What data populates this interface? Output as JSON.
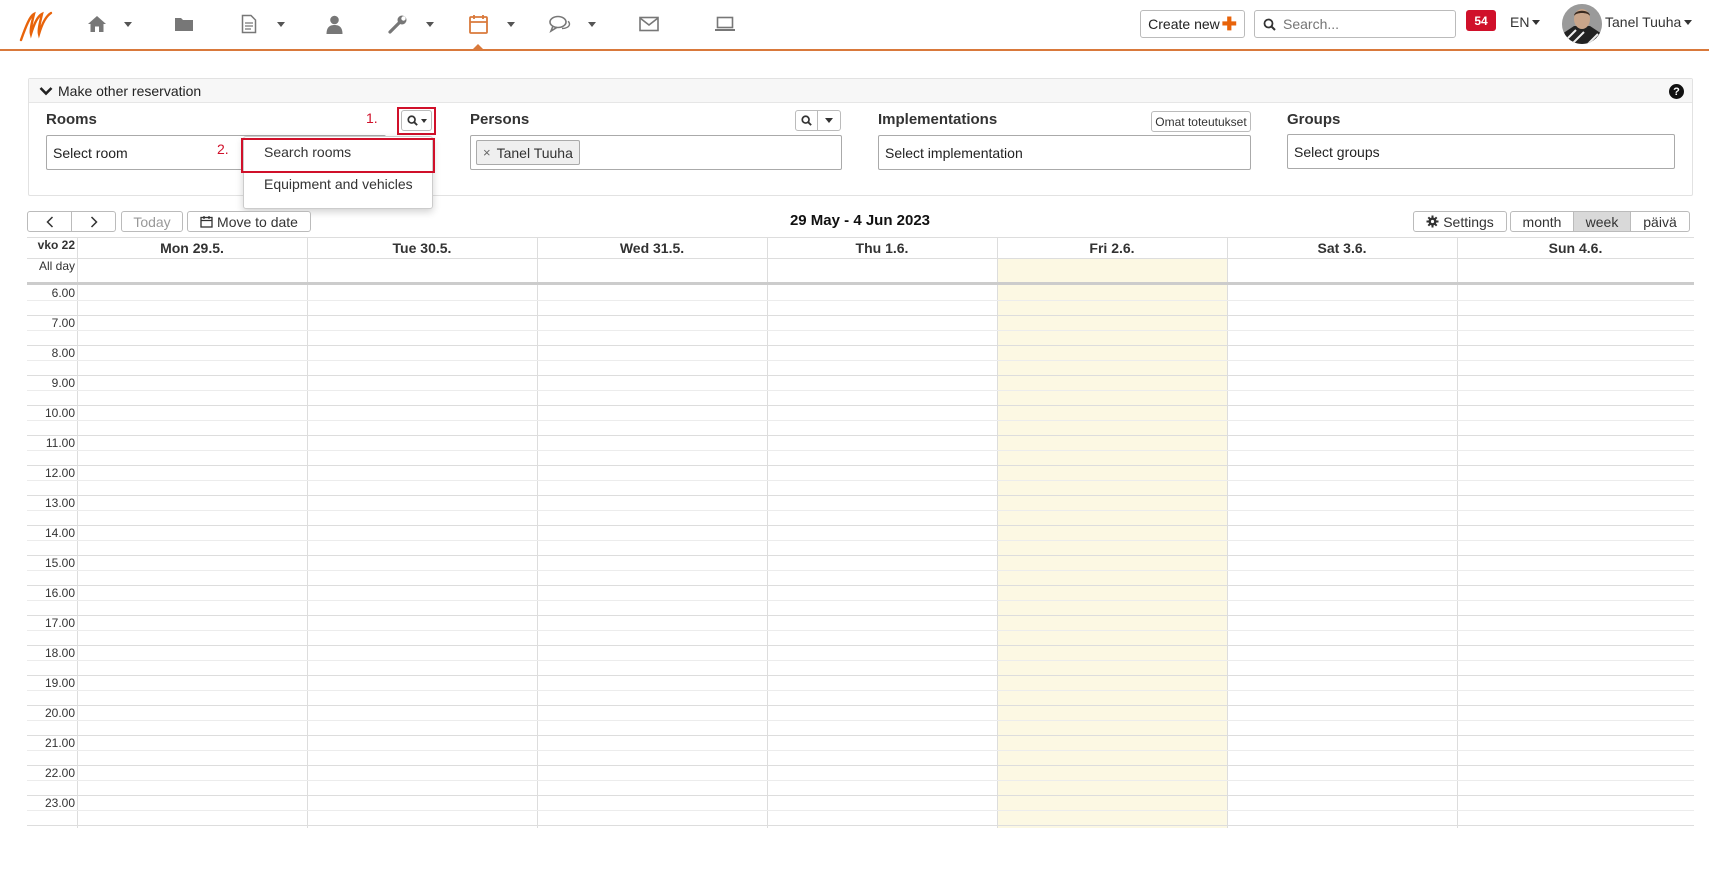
{
  "nav": {
    "items": [
      {
        "name": "home",
        "icon": "home-icon",
        "has_menu": true
      },
      {
        "name": "folder",
        "icon": "folder-icon",
        "has_menu": false
      },
      {
        "name": "document",
        "icon": "document-icon",
        "has_menu": true
      },
      {
        "name": "user",
        "icon": "user-icon",
        "has_menu": false
      },
      {
        "name": "tools",
        "icon": "wrench-icon",
        "has_menu": true
      },
      {
        "name": "calendar",
        "icon": "calendar-icon",
        "has_menu": true,
        "active": true
      },
      {
        "name": "messages",
        "icon": "chat-icon",
        "has_menu": true
      },
      {
        "name": "mail",
        "icon": "envelope-icon",
        "has_menu": false
      },
      {
        "name": "laptop",
        "icon": "laptop-icon",
        "has_menu": false
      }
    ],
    "create_new_label": "Create new",
    "search_placeholder": "Search...",
    "notification_count": "54",
    "language": "EN",
    "user_name": "Tanel Tuuha",
    "accent_color": "#d9793b",
    "badge_color": "#d0102a"
  },
  "reservation": {
    "title": "Make other reservation",
    "rooms": {
      "label": "Rooms",
      "placeholder": "Select room"
    },
    "persons": {
      "label": "Persons",
      "selected": [
        "Tanel Tuuha"
      ]
    },
    "implementations": {
      "label": "Implementations",
      "button_label": "Omat toteutukset",
      "placeholder": "Select implementation"
    },
    "groups": {
      "label": "Groups",
      "placeholder": "Select groups"
    },
    "dropdown": {
      "items": [
        "Search rooms",
        "Equipment and vehicles"
      ]
    },
    "annotations": {
      "step1": "1.",
      "step2": "2."
    }
  },
  "calendar": {
    "today_label": "Today",
    "move_to_date_label": "Move to date",
    "range_title": "29 May - 4 Jun 2023",
    "settings_label": "Settings",
    "views": [
      "month",
      "week",
      "päivä"
    ],
    "active_view": "week",
    "week_label": "vko 22",
    "all_day_label": "All day",
    "days": [
      "Mon 29.5.",
      "Tue 30.5.",
      "Wed 31.5.",
      "Thu 1.6.",
      "Fri 2.6.",
      "Sat 3.6.",
      "Sun 4.6."
    ],
    "today_day": "Fri 2.6.",
    "hours": [
      "6.00",
      "7.00",
      "8.00",
      "9.00",
      "10.00",
      "11.00",
      "12.00",
      "13.00",
      "14.00",
      "15.00",
      "16.00",
      "17.00",
      "18.00",
      "19.00",
      "20.00",
      "21.00",
      "22.00",
      "23.00"
    ],
    "today_color": "#fcf8e3"
  }
}
